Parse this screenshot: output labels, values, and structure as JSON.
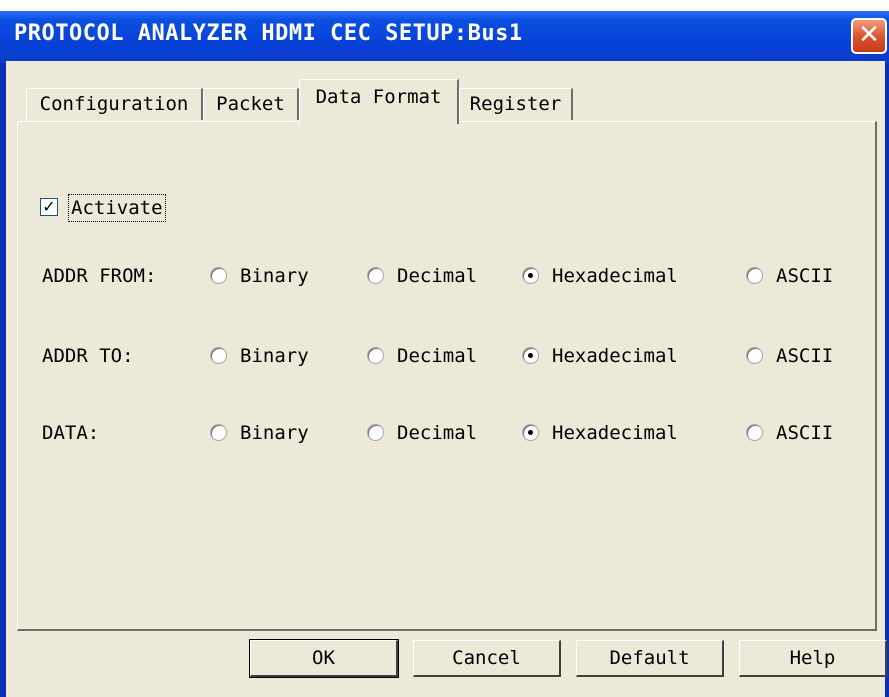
{
  "window": {
    "title": "PROTOCOL ANALYZER HDMI CEC SETUP:Bus1",
    "close_glyph": "✕"
  },
  "tabs": [
    {
      "label": "Configuration",
      "active": false
    },
    {
      "label": "Packet",
      "active": false
    },
    {
      "label": "Data Format",
      "active": true
    },
    {
      "label": "Register",
      "active": false
    }
  ],
  "activate": {
    "label": "Activate",
    "checked": true,
    "check_glyph": "✓"
  },
  "formats": [
    {
      "label": "ADDR FROM:",
      "options": [
        "Binary",
        "Decimal",
        "Hexadecimal",
        "ASCII"
      ],
      "selected": "Hexadecimal"
    },
    {
      "label": "ADDR TO:",
      "options": [
        "Binary",
        "Decimal",
        "Hexadecimal",
        "ASCII"
      ],
      "selected": "Hexadecimal"
    },
    {
      "label": "DATA:",
      "options": [
        "Binary",
        "Decimal",
        "Hexadecimal",
        "ASCII"
      ],
      "selected": "Hexadecimal"
    }
  ],
  "buttons": {
    "ok": "OK",
    "cancel": "Cancel",
    "default": "Default",
    "help": "Help"
  }
}
